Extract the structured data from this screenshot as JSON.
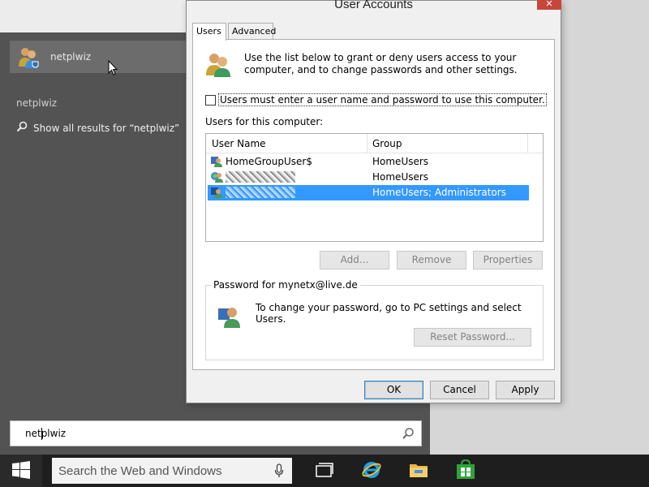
{
  "start": {
    "best_match_label": "netplwiz",
    "section_label": "netplwiz",
    "show_all_prefix": "Show all results for “netplwiz”",
    "query": "netplwiz"
  },
  "taskbar": {
    "search_placeholder": "Search the Web and Windows",
    "icons": [
      "windows-logo-icon",
      "microphone-icon",
      "task-view-icon",
      "internet-explorer-icon",
      "file-explorer-icon",
      "store-icon"
    ]
  },
  "dialog": {
    "title": "User Accounts",
    "close_glyph": "✕",
    "tabs": [
      {
        "label": "Users",
        "active": true
      },
      {
        "label": "Advanced",
        "active": false
      }
    ],
    "intro_text": "Use the list below to grant or deny users access to your computer, and to change passwords and other settings.",
    "require_login_label": "Users must enter a user name and password to use this computer.",
    "require_login_checked": false,
    "users_label": "Users for this computer:",
    "columns": [
      "User Name",
      "Group"
    ],
    "users": [
      {
        "name": "HomeGroupUser$",
        "group": "HomeUsers",
        "obscured": false,
        "selected": false
      },
      {
        "name": "",
        "group": "HomeUsers",
        "obscured": true,
        "selected": false
      },
      {
        "name": "",
        "group": "HomeUsers; Administrators",
        "obscured": true,
        "selected": true
      }
    ],
    "add_label": "Add...",
    "remove_label": "Remove",
    "properties_label": "Properties",
    "password_group_title": "Password for mynetx@live.de",
    "password_text": "To change your password, go to PC settings and select Users.",
    "reset_password_label": "Reset Password...",
    "ok_label": "OK",
    "cancel_label": "Cancel",
    "apply_label": "Apply"
  },
  "colors": {
    "selection": "#3399ff",
    "panel": "#535353",
    "taskbar": "#1e1e1e"
  }
}
